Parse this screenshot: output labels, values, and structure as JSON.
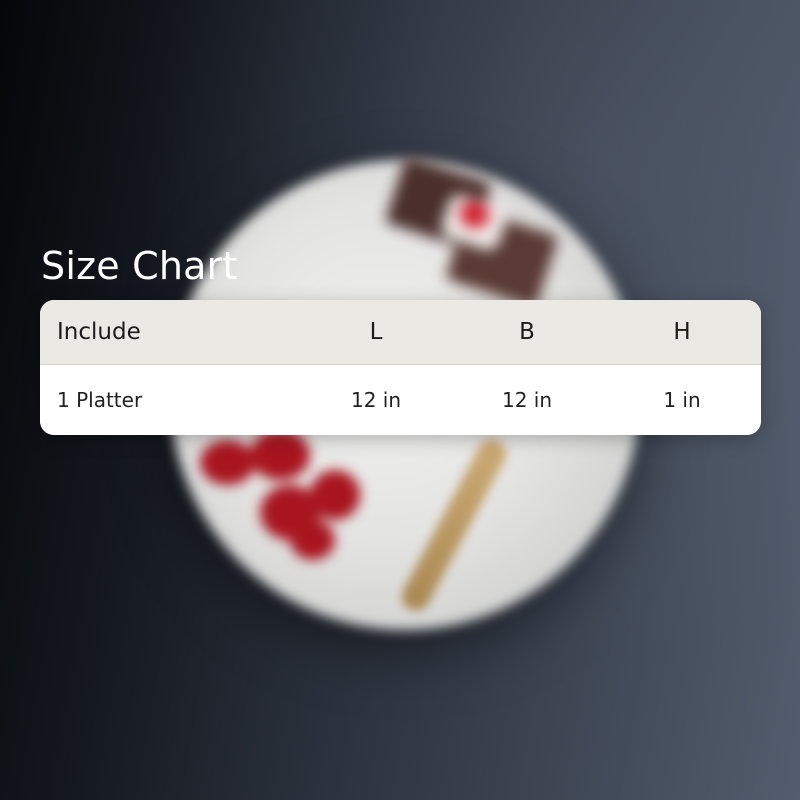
{
  "heading": "Size Chart",
  "table": {
    "columns": [
      "Include",
      "L",
      "B",
      "H"
    ],
    "rows": [
      {
        "include": "1 Platter",
        "l": "12 in",
        "b": "12 in",
        "h": "1 in"
      }
    ]
  },
  "colors": {
    "header_background": "#ebe9e3",
    "body_background": "#ffffff",
    "title_text": "#ffffff",
    "table_text": "#1b1b1b"
  }
}
